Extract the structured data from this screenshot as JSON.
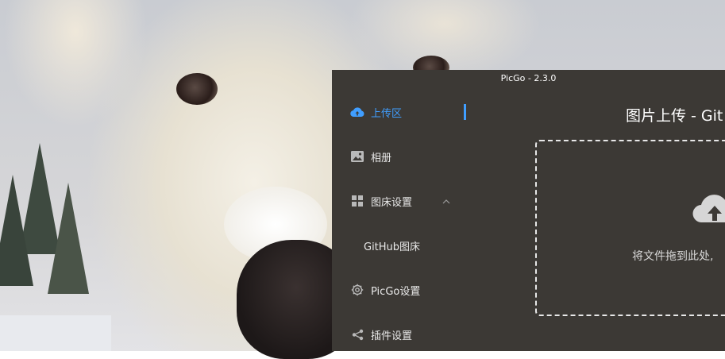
{
  "window": {
    "title": "PicGo - 2.3.0"
  },
  "sidebar": {
    "items": [
      {
        "label": "上传区",
        "icon": "cloud-upload-icon",
        "active": true
      },
      {
        "label": "相册",
        "icon": "image-icon"
      },
      {
        "label": "图床设置",
        "icon": "grid-icon"
      },
      {
        "label": "GitHub图床"
      },
      {
        "label": "PicGo设置",
        "icon": "gear-icon"
      },
      {
        "label": "插件设置",
        "icon": "share-icon"
      }
    ]
  },
  "main": {
    "title": "图片上传 - Git",
    "dropzone_text": "将文件拖到此处,"
  },
  "colors": {
    "accent": "#409eff",
    "window_bg": "#3c3935"
  }
}
